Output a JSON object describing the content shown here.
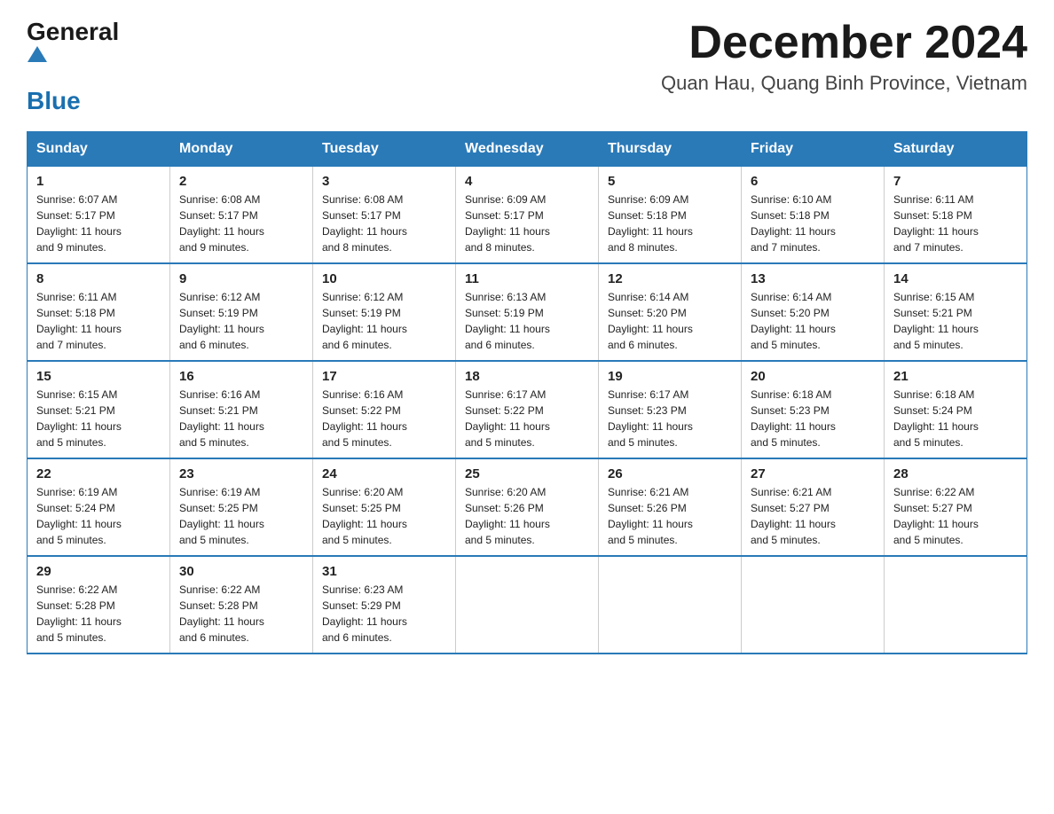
{
  "header": {
    "logo": {
      "text_general": "General",
      "text_blue": "Blue",
      "triangle_label": "logo-triangle"
    },
    "title": "December 2024",
    "location": "Quan Hau, Quang Binh Province, Vietnam"
  },
  "days_of_week": [
    "Sunday",
    "Monday",
    "Tuesday",
    "Wednesday",
    "Thursday",
    "Friday",
    "Saturday"
  ],
  "weeks": [
    [
      {
        "day": "1",
        "sunrise": "6:07 AM",
        "sunset": "5:17 PM",
        "daylight": "11 hours and 9 minutes."
      },
      {
        "day": "2",
        "sunrise": "6:08 AM",
        "sunset": "5:17 PM",
        "daylight": "11 hours and 9 minutes."
      },
      {
        "day": "3",
        "sunrise": "6:08 AM",
        "sunset": "5:17 PM",
        "daylight": "11 hours and 8 minutes."
      },
      {
        "day": "4",
        "sunrise": "6:09 AM",
        "sunset": "5:17 PM",
        "daylight": "11 hours and 8 minutes."
      },
      {
        "day": "5",
        "sunrise": "6:09 AM",
        "sunset": "5:18 PM",
        "daylight": "11 hours and 8 minutes."
      },
      {
        "day": "6",
        "sunrise": "6:10 AM",
        "sunset": "5:18 PM",
        "daylight": "11 hours and 7 minutes."
      },
      {
        "day": "7",
        "sunrise": "6:11 AM",
        "sunset": "5:18 PM",
        "daylight": "11 hours and 7 minutes."
      }
    ],
    [
      {
        "day": "8",
        "sunrise": "6:11 AM",
        "sunset": "5:18 PM",
        "daylight": "11 hours and 7 minutes."
      },
      {
        "day": "9",
        "sunrise": "6:12 AM",
        "sunset": "5:19 PM",
        "daylight": "11 hours and 6 minutes."
      },
      {
        "day": "10",
        "sunrise": "6:12 AM",
        "sunset": "5:19 PM",
        "daylight": "11 hours and 6 minutes."
      },
      {
        "day": "11",
        "sunrise": "6:13 AM",
        "sunset": "5:19 PM",
        "daylight": "11 hours and 6 minutes."
      },
      {
        "day": "12",
        "sunrise": "6:14 AM",
        "sunset": "5:20 PM",
        "daylight": "11 hours and 6 minutes."
      },
      {
        "day": "13",
        "sunrise": "6:14 AM",
        "sunset": "5:20 PM",
        "daylight": "11 hours and 5 minutes."
      },
      {
        "day": "14",
        "sunrise": "6:15 AM",
        "sunset": "5:21 PM",
        "daylight": "11 hours and 5 minutes."
      }
    ],
    [
      {
        "day": "15",
        "sunrise": "6:15 AM",
        "sunset": "5:21 PM",
        "daylight": "11 hours and 5 minutes."
      },
      {
        "day": "16",
        "sunrise": "6:16 AM",
        "sunset": "5:21 PM",
        "daylight": "11 hours and 5 minutes."
      },
      {
        "day": "17",
        "sunrise": "6:16 AM",
        "sunset": "5:22 PM",
        "daylight": "11 hours and 5 minutes."
      },
      {
        "day": "18",
        "sunrise": "6:17 AM",
        "sunset": "5:22 PM",
        "daylight": "11 hours and 5 minutes."
      },
      {
        "day": "19",
        "sunrise": "6:17 AM",
        "sunset": "5:23 PM",
        "daylight": "11 hours and 5 minutes."
      },
      {
        "day": "20",
        "sunrise": "6:18 AM",
        "sunset": "5:23 PM",
        "daylight": "11 hours and 5 minutes."
      },
      {
        "day": "21",
        "sunrise": "6:18 AM",
        "sunset": "5:24 PM",
        "daylight": "11 hours and 5 minutes."
      }
    ],
    [
      {
        "day": "22",
        "sunrise": "6:19 AM",
        "sunset": "5:24 PM",
        "daylight": "11 hours and 5 minutes."
      },
      {
        "day": "23",
        "sunrise": "6:19 AM",
        "sunset": "5:25 PM",
        "daylight": "11 hours and 5 minutes."
      },
      {
        "day": "24",
        "sunrise": "6:20 AM",
        "sunset": "5:25 PM",
        "daylight": "11 hours and 5 minutes."
      },
      {
        "day": "25",
        "sunrise": "6:20 AM",
        "sunset": "5:26 PM",
        "daylight": "11 hours and 5 minutes."
      },
      {
        "day": "26",
        "sunrise": "6:21 AM",
        "sunset": "5:26 PM",
        "daylight": "11 hours and 5 minutes."
      },
      {
        "day": "27",
        "sunrise": "6:21 AM",
        "sunset": "5:27 PM",
        "daylight": "11 hours and 5 minutes."
      },
      {
        "day": "28",
        "sunrise": "6:22 AM",
        "sunset": "5:27 PM",
        "daylight": "11 hours and 5 minutes."
      }
    ],
    [
      {
        "day": "29",
        "sunrise": "6:22 AM",
        "sunset": "5:28 PM",
        "daylight": "11 hours and 5 minutes."
      },
      {
        "day": "30",
        "sunrise": "6:22 AM",
        "sunset": "5:28 PM",
        "daylight": "11 hours and 6 minutes."
      },
      {
        "day": "31",
        "sunrise": "6:23 AM",
        "sunset": "5:29 PM",
        "daylight": "11 hours and 6 minutes."
      },
      null,
      null,
      null,
      null
    ]
  ],
  "labels": {
    "sunrise": "Sunrise:",
    "sunset": "Sunset:",
    "daylight": "Daylight:"
  }
}
